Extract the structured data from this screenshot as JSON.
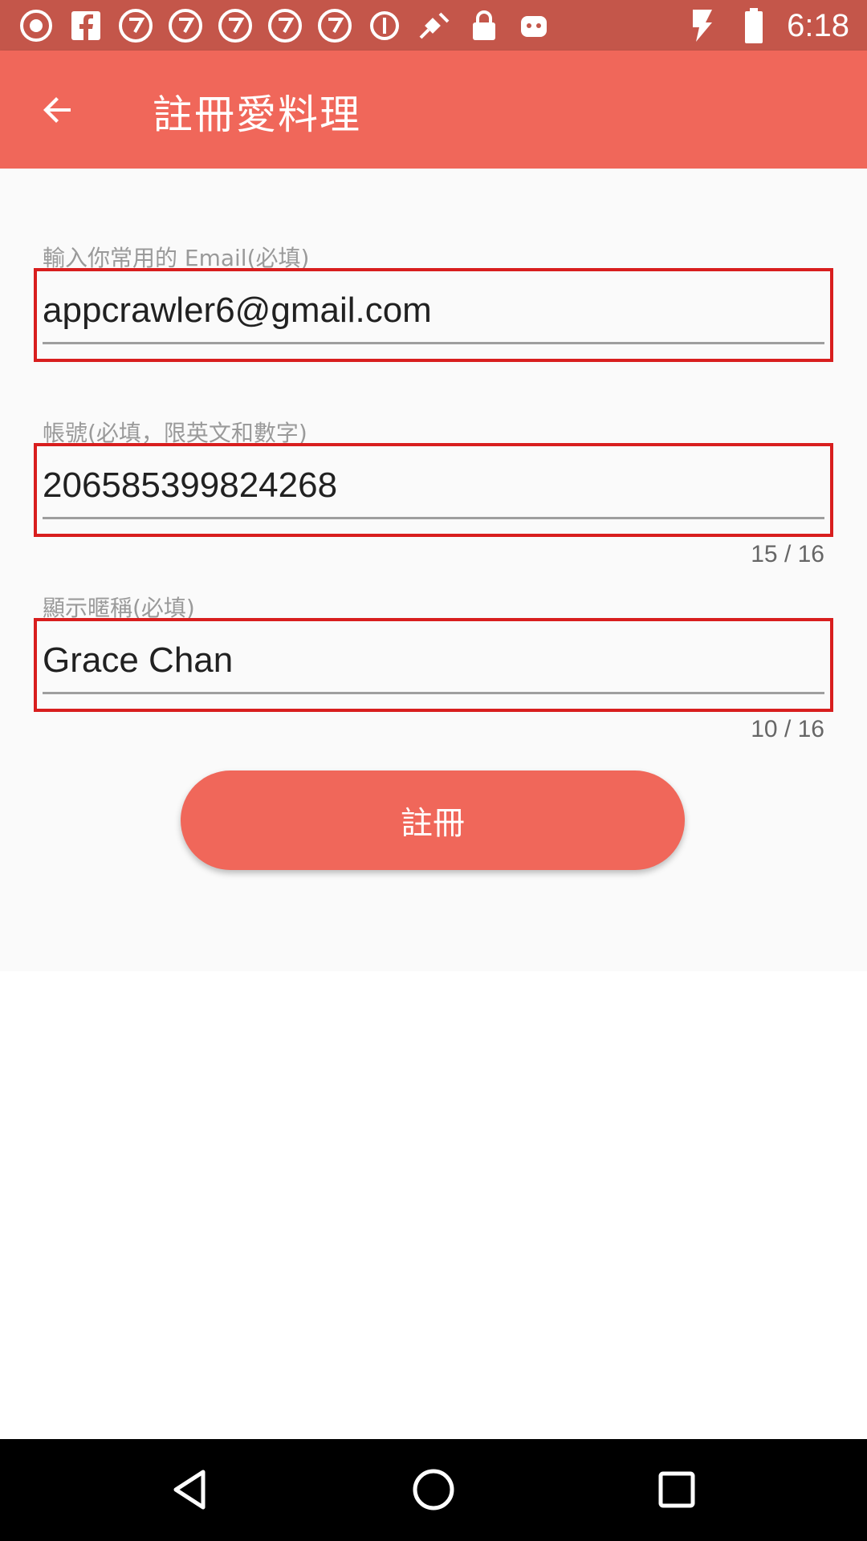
{
  "status_bar": {
    "time": "6:18",
    "icons": [
      "abc-news-icon",
      "facebook-icon",
      "abc7-icon",
      "abc7-icon",
      "abc7-icon",
      "abc7-icon",
      "abc7-icon",
      "info-circle-icon",
      "fake-gps-icon",
      "lock-icon",
      "android-icon"
    ],
    "right_icons": [
      "flash-icon",
      "battery-icon"
    ]
  },
  "app_bar": {
    "title": "註冊愛料理",
    "back_icon": "arrow-back-icon",
    "color": "#f0675a"
  },
  "form": {
    "email": {
      "label": "輸入你常用的 Email(必填)",
      "value": "appcrawler6@gmail.com"
    },
    "account": {
      "label": "帳號(必填，限英文和數字)",
      "value": "206585399824268",
      "counter": "15 / 16"
    },
    "nickname": {
      "label": "顯示暱稱(必填)",
      "value": "Grace Chan",
      "counter": "10 / 16"
    },
    "submit_label": "註冊"
  },
  "nav_bar": {
    "back_icon": "triangle-back-icon",
    "home_icon": "circle-home-icon",
    "recents_icon": "square-recents-icon"
  },
  "colors": {
    "accent": "#f0675a",
    "status_bar": "#c4564a",
    "highlight_box": "#d81e1e"
  }
}
